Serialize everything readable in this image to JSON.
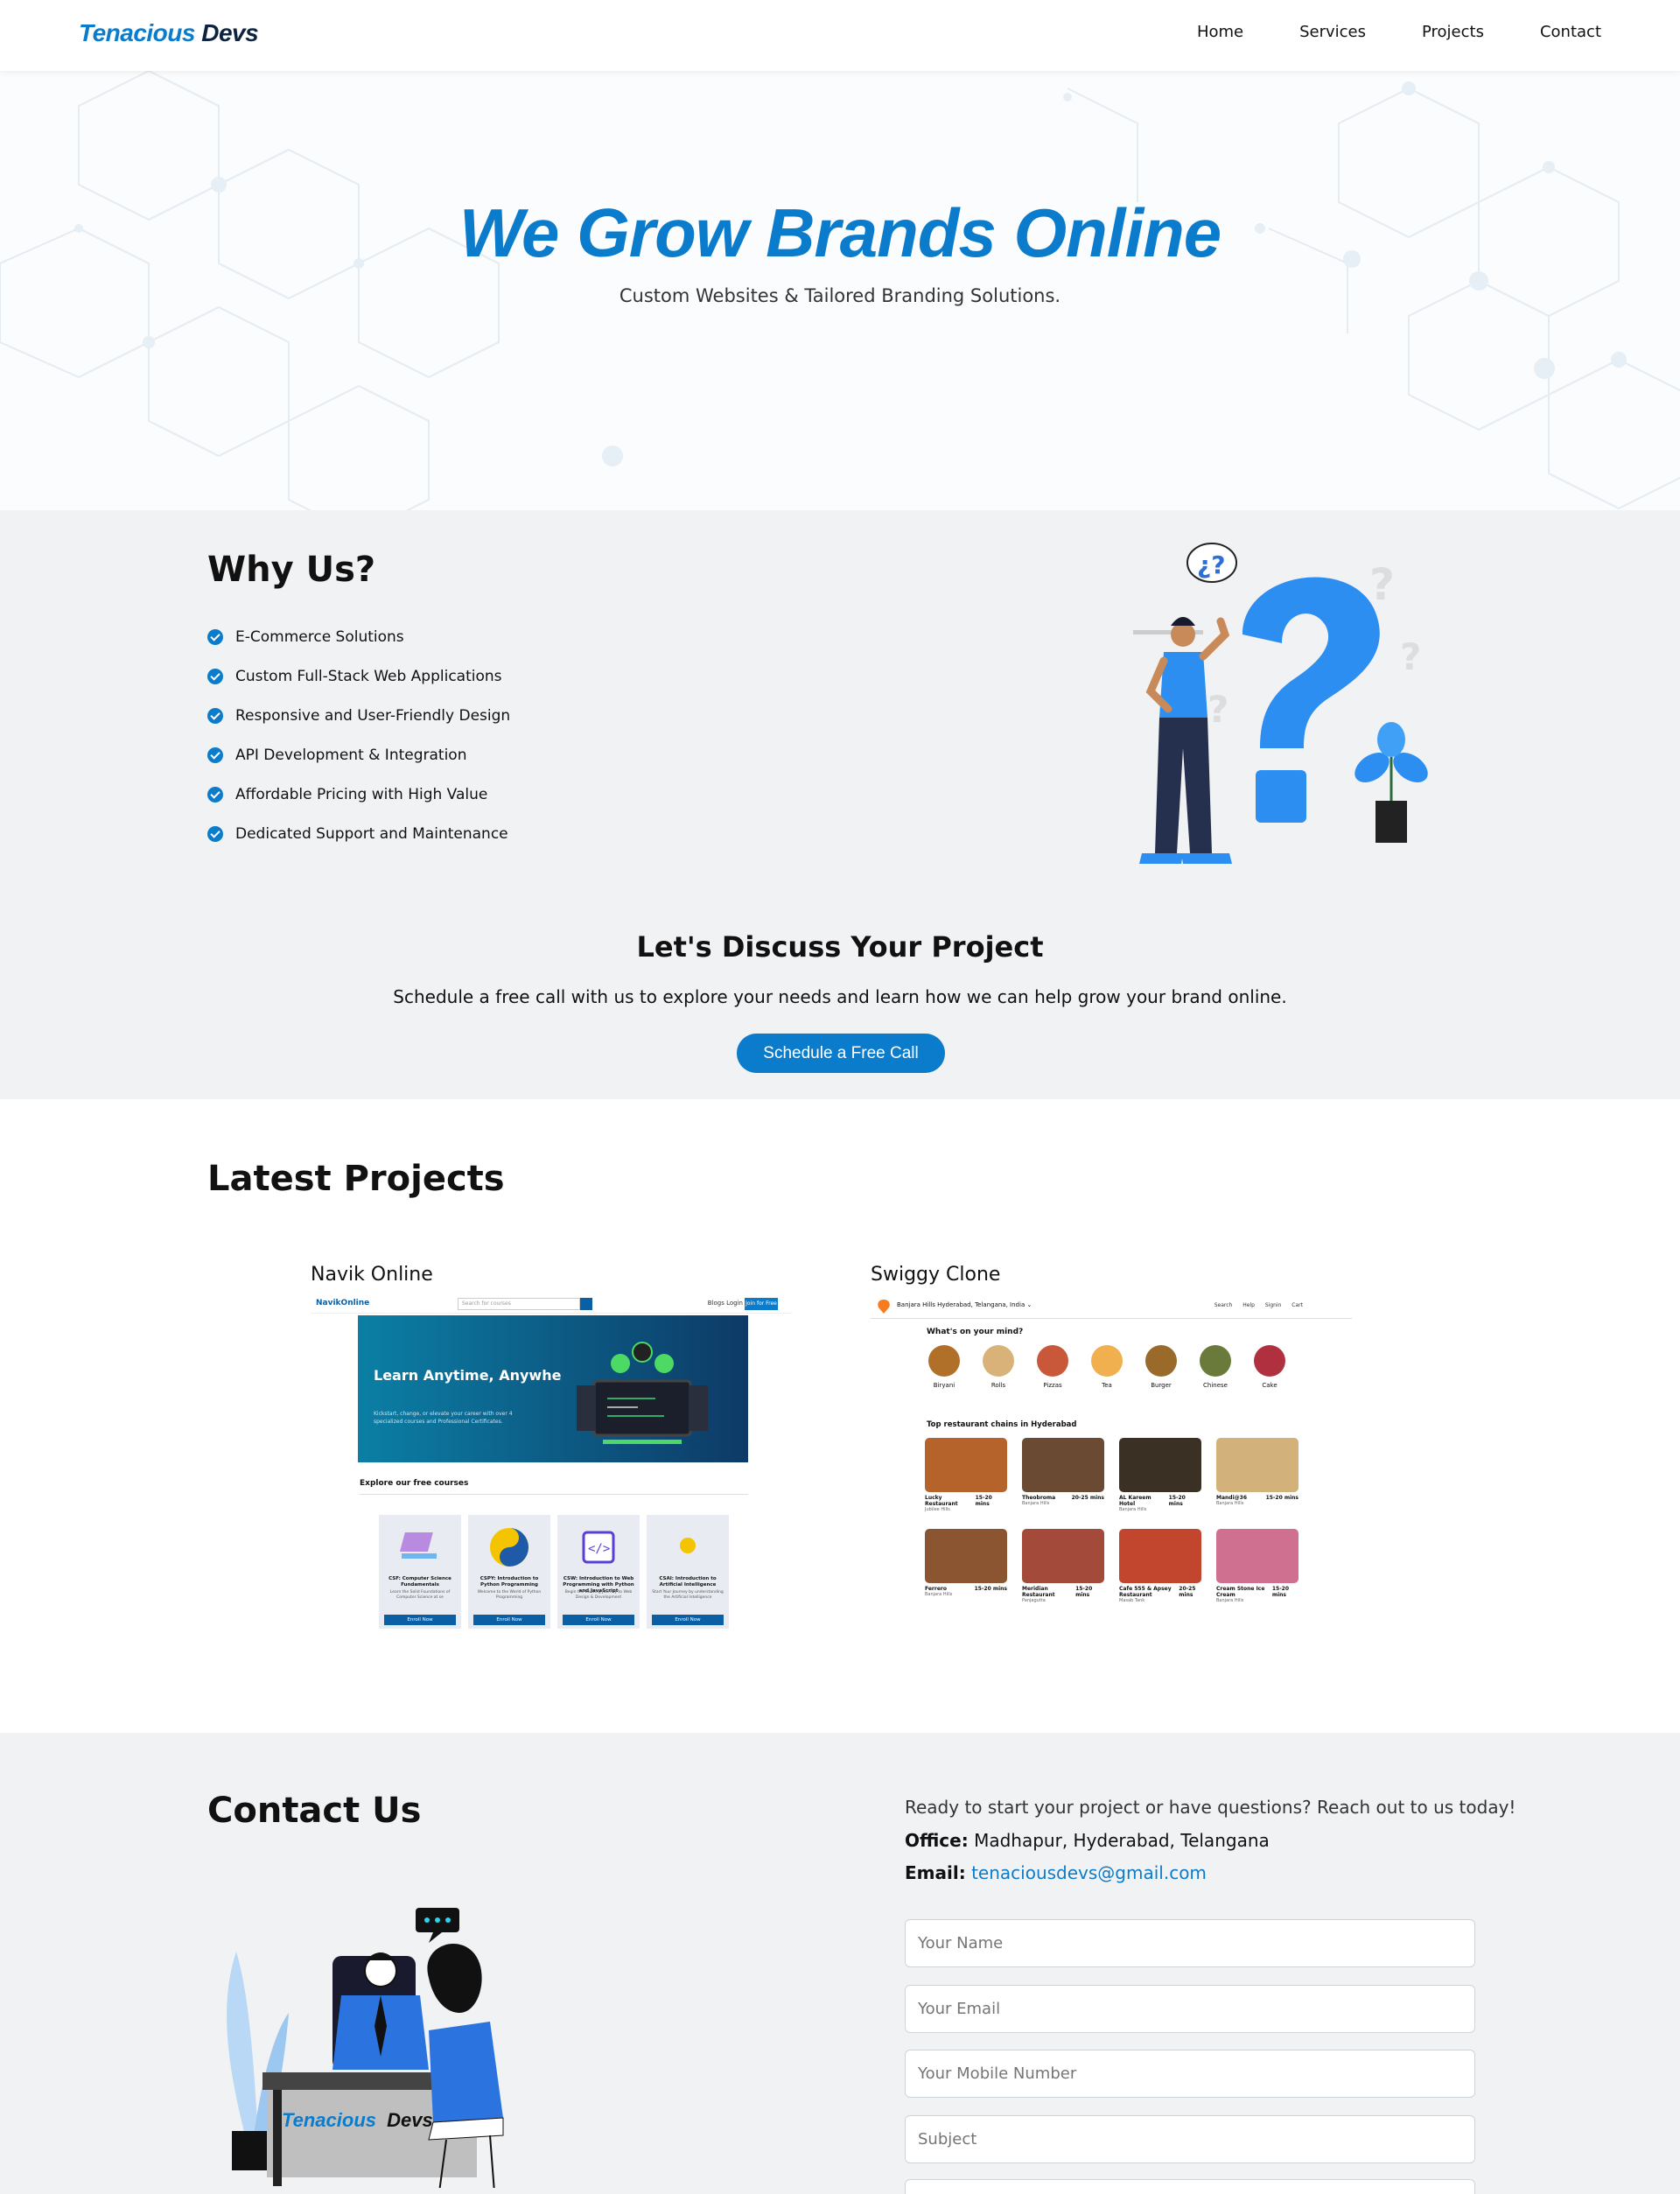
{
  "brand": {
    "part1": "Tenacious",
    "part2": "Devs"
  },
  "nav": {
    "items": [
      "Home",
      "Services",
      "Projects",
      "Contact"
    ]
  },
  "hero": {
    "title": "We Grow Brands Online",
    "subtitle": "Custom Websites & Tailored Branding Solutions."
  },
  "why": {
    "title": "Why Us?",
    "items": [
      "E-Commerce Solutions",
      "Custom Full-Stack Web Applications",
      "Responsive and User-Friendly Design",
      "API Development & Integration",
      "Affordable Pricing with High Value",
      "Dedicated Support and Maintenance"
    ]
  },
  "discuss": {
    "title": "Let's Discuss Your Project",
    "text": "Schedule a free call with us to explore your needs and learn how we can help grow your brand online.",
    "button": "Schedule a Free Call"
  },
  "projects": {
    "title": "Latest Projects",
    "items": [
      {
        "name": "Navik Online",
        "preview": {
          "logo": "NavikOnline",
          "search_placeholder": "Search for courses",
          "links": "Blogs   Login",
          "join": "Join for Free",
          "hero_title": "Learn Anytime, Anywhe",
          "hero_text": "Kickstart, change, or elevate your career with over 4 specialized courses and Professional Certificates.",
          "explore": "Explore our free courses",
          "courses": [
            {
              "title": "CSF: Computer Science Fundamentals",
              "desc": "Learn the Solid Foundations of Computer Science at se",
              "button": "Enroll Now"
            },
            {
              "title": "CSPY: Introduction to Python Programming",
              "desc": "Welcome to the World of Python Programming",
              "button": "Enroll Now"
            },
            {
              "title": "CSW: Introduction to Web Programming with Python and JavaScript",
              "desc": "Begin the Exciting Journey to Web Design & Development",
              "button": "Enroll Now"
            },
            {
              "title": "CSAI: Introduction to Artificial Intelligence",
              "desc": "Start Your Journey by understanding the Artificial Intelligence",
              "button": "Enroll Now"
            }
          ]
        }
      },
      {
        "name": "Swiggy Clone",
        "preview": {
          "location": "Banjara Hills  Hyderabad, Telangana, India ⌄",
          "nav": "Search  Help  Signin  Cart",
          "mind": "What's on your mind?",
          "dishes": [
            "Biryani",
            "Rolls",
            "Pizzas",
            "Tea",
            "Burger",
            "Chinese",
            "Cake"
          ],
          "top_title": "Top restaurant chains in Hyderabad",
          "restaurants": [
            {
              "name": "Lucky Restaurant",
              "time": "15-20 mins",
              "area": "Jubilee Hills"
            },
            {
              "name": "Theobroma",
              "time": "20-25 mins",
              "area": "Banjara Hills"
            },
            {
              "name": "AL Kareem Hotel",
              "time": "15-20 mins",
              "area": "Banjara Hills"
            },
            {
              "name": "Mandi@36",
              "time": "15-20 mins",
              "area": "Banjara Hills"
            },
            {
              "name": "Ferrero",
              "time": "15-20 mins",
              "area": "Banjara Hills"
            },
            {
              "name": "Meridian Restaurant",
              "time": "15-20 mins",
              "area": "Panjagutta"
            },
            {
              "name": "Cafe 555 & Apsey Restaurant",
              "time": "20-25 mins",
              "area": "Masab Tank"
            },
            {
              "name": "Cream Stone Ice Cream",
              "time": "15-20 mins",
              "area": "Banjara Hills"
            }
          ]
        }
      }
    ]
  },
  "contact": {
    "title": "Contact Us",
    "lead": "Ready to start your project or have questions? Reach out to us today!",
    "office_label": "Office:",
    "office": "Madhapur, Hyderabad, Telangana",
    "email_label": "Email:",
    "email": "tenaciousdevs@gmail.com",
    "fields": [
      "Your Name",
      "Your Email",
      "Your Mobile Number",
      "Subject"
    ],
    "desk_brand_a": "Tenacious",
    "desk_brand_b": "Devs"
  },
  "colors": {
    "accent": "#0b7ccc",
    "dark": "#0d2340",
    "section_bg": "#f1f2f4"
  }
}
